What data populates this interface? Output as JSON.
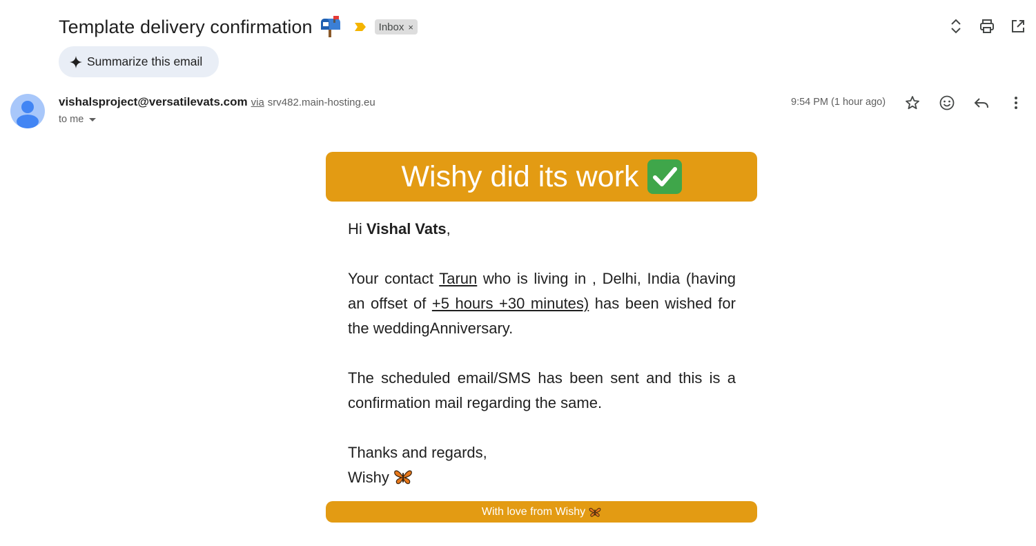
{
  "subject": {
    "title": "Template delivery confirmation",
    "emoji_icon": "mailbox-icon",
    "label": "Inbox",
    "label_remove": "×"
  },
  "summarize": {
    "label": "Summarize this email"
  },
  "sender": {
    "email": "vishalsproject@versatilevats.com",
    "via_label": "via",
    "via_host": "srv482.main-hosting.eu",
    "to_label": "to me",
    "time": "9:54 PM (1 hour ago)"
  },
  "top_actions": [
    "expand-collapse-icon",
    "print-icon",
    "open-new-window-icon"
  ],
  "message_actions": [
    "star-icon",
    "emoji-reaction-icon",
    "reply-icon",
    "more-vert-icon"
  ],
  "email": {
    "banner_title": "Wishy did its work",
    "banner_emoji": "check-mark-icon",
    "greeting_prefix": "Hi ",
    "greeting_name": "Vishal Vats",
    "greeting_suffix": ",",
    "p1_a": "Your contact ",
    "contact_name": "Tarun",
    "p1_b": " who is living in , Delhi, India (having an offset of ",
    "offset": "+5 hours +30 minutes)",
    "p1_c": " has been wished for the weddingAnniversary.",
    "p2": "The scheduled email/SMS has been sent and this is a confirmation mail regarding the same.",
    "closing": "Thanks and regards,",
    "signature": "Wishy",
    "footer": "With love from Wishy"
  },
  "colors": {
    "accent": "#e39b13",
    "chip_bg": "#dddddd",
    "summarize_bg": "#e9eef6",
    "avatar_bg": "#a8c7fa",
    "avatar_fg": "#4285f4",
    "importance": "#f4b400"
  }
}
